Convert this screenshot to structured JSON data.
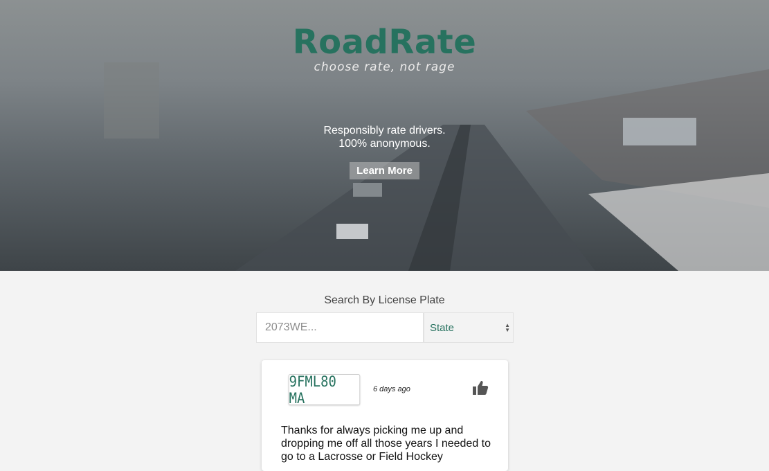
{
  "hero": {
    "brand": "RoadRate",
    "tagline": "choose rate, not rage",
    "pitch_line1": "Responsibly rate drivers.",
    "pitch_line2": "100% anonymous.",
    "learn_more": "Learn More"
  },
  "search": {
    "title": "Search By License Plate",
    "placeholder": "2073WE...",
    "state_label": "State",
    "state_arrows": "▲▼"
  },
  "card": {
    "plate": "9FML80 MA",
    "time_ago": "6 days ago",
    "review": "Thanks for always picking me up and dropping me off all those years I needed to go to a Lacrosse or Field Hockey"
  },
  "colors": {
    "brand": "#27725f",
    "background": "#f3f3f3"
  },
  "icons": {
    "like": "thumbs-up-icon"
  }
}
